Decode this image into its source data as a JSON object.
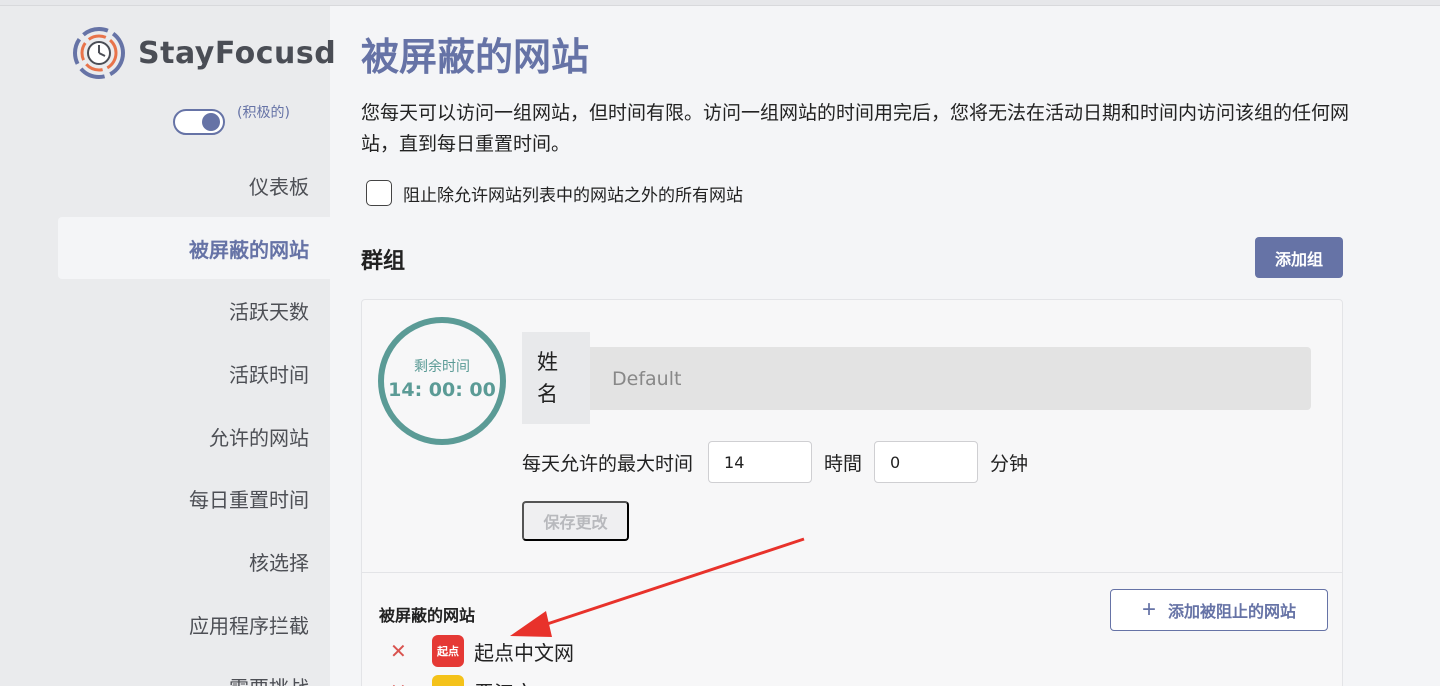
{
  "app": {
    "name": "StayFocusd",
    "toggle_label": "(积极的)"
  },
  "sidebar": {
    "items": [
      {
        "label": "仪表板"
      },
      {
        "label": "被屏蔽的网站"
      },
      {
        "label": "活跃天数"
      },
      {
        "label": "活跃时间"
      },
      {
        "label": "允许的网站"
      },
      {
        "label": "每日重置时间"
      },
      {
        "label": "核选择"
      },
      {
        "label": "应用程序拦截"
      },
      {
        "label": "需要挑战"
      }
    ]
  },
  "main": {
    "title": "被屏蔽的网站",
    "description": "您每天可以访问一组网站，但时间有限。访问一组网站的时间用完后，您将无法在活动日期和时间内访问该组的任何网站，直到每日重置时间。",
    "allowlist_only_label": "阻止除允许网站列表中的网站之外的所有网站",
    "groups_title": "群组",
    "add_group_label": "添加组"
  },
  "group": {
    "timer_label": "剩余时间",
    "timer_value": "14: 00: 00",
    "name_label": "姓名",
    "name_placeholder": "Default",
    "max_time_label": "每天允许的最大时间",
    "hours_value": "14",
    "hours_unit": "時間",
    "minutes_value": "0",
    "minutes_unit": "分钟",
    "save_label": "保存更改",
    "blocked_sites_title": "被屏蔽的网站",
    "add_blocked_site_label": "添加被阻止的网站",
    "sites": [
      {
        "favicon_text": "起点",
        "name": "起点中文网"
      },
      {
        "favicon_text": "",
        "name": "晋江文"
      }
    ]
  },
  "colors": {
    "accent": "#6673a6",
    "timer": "#5b9b96",
    "remove": "#d9534f",
    "annotation_arrow": "#e8322b"
  }
}
